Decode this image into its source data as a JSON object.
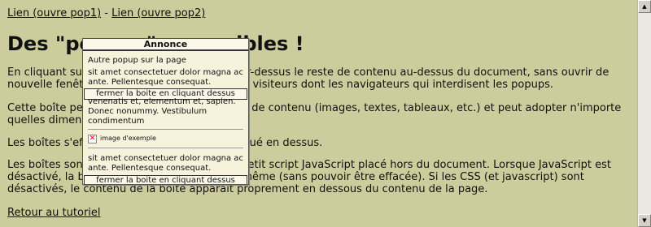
{
  "nav": {
    "link1": "Lien (ouvre pop1)",
    "separator": " - ",
    "link2": "Lien (ouvre pop2)"
  },
  "heading": "Des \"popups\" accessibles !",
  "paragraphs": [
    "En cliquant sur un lien, une boîte apparaît par-dessus le reste de contenu au-dessus du document, sans ouvrir de nouvelle fenêtre. Elle est donc accessible aux visiteurs dont les navigateurs qui interdisent les popups.",
    "Cette boîte peut contenir n'importe quel type de contenu (images, textes, tableaux, etc.) et peut adopter n'importe quelles dimension, couleur ou position.",
    "Les boîtes s'effacent en cliquant sur le lien situé en dessus.",
    "Les boîtes sont affichées et effacées par un petit script JavaScript placé hors du document. Lorsque JavaScript est désactivé, la boîte est affichée et placée de même (sans pouvoir être effacée). Si les CSS (et javascript) sont désactivés, le contenu de la boîte apparaît proprement en dessous du contenu de la page."
  ],
  "back_link": "Retour au tutoriel",
  "popup": {
    "title": "Annonce",
    "intro_line": "Autre popup sur la page",
    "text1": "sit amet consectetuer dolor magna ac ante. Pellentesque consequat.",
    "close_label": "fermer la boite en cliquant dessus",
    "overlap_text": "venenatis et, elementum et, sapien. Donec nonummy. Vestibulum condimentum",
    "image_label": "image d'exemple",
    "text2": "sit amet consectetuer dolor magna ac ante. Pellentesque consequat.",
    "close_label_bottom": "fermer la boite en cliquant dessus"
  },
  "scrollbar": {
    "up_icon": "▲",
    "down_icon": "▼"
  },
  "colors": {
    "background": "#cccc9c",
    "popup_background": "#f6f2dc"
  }
}
